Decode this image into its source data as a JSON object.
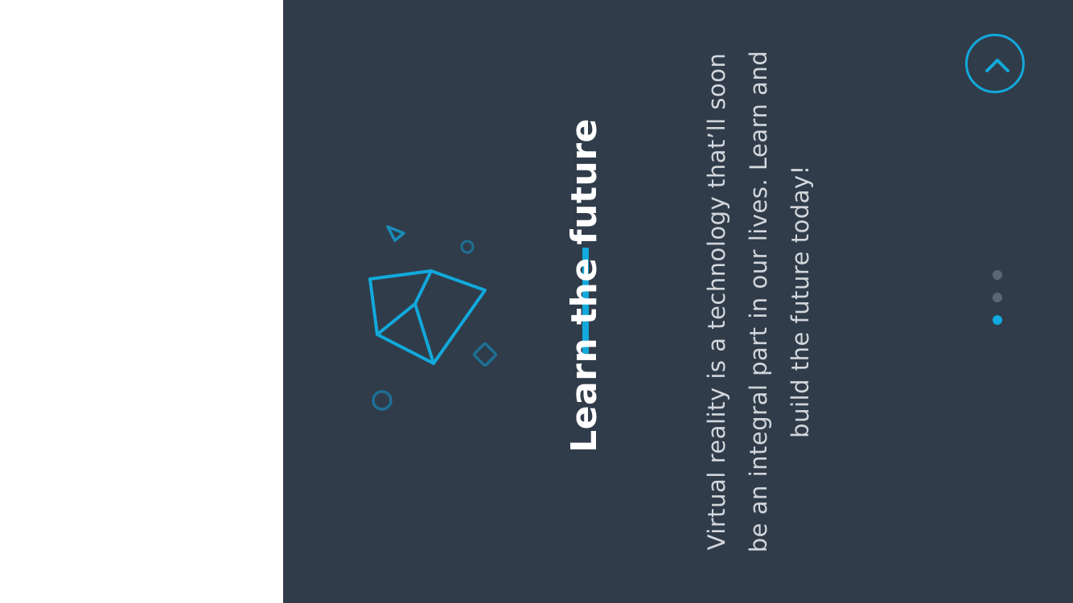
{
  "slide": {
    "title": "Learn the future",
    "description": "Virtual reality is a technology that’ll soon be an integral part in our lives. Learn and build the future today!"
  },
  "pagination": {
    "total": 3,
    "active_index": 3
  },
  "colors": {
    "background": "#303c4a",
    "accent": "#12a9dc",
    "title": "#ffffff",
    "description": "#d2d6db",
    "dot_inactive": "#5b6673",
    "dot_active": "#12a9dc",
    "decor_muted": "#1e6f94"
  },
  "icons": {
    "up_button": "chevron-up-icon",
    "illustration": "vr-crystal-illustration"
  }
}
